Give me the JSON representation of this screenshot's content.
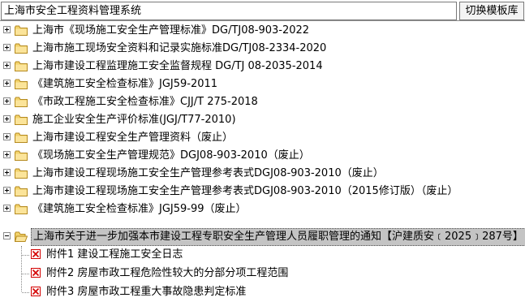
{
  "window": {
    "title": "上海市安全工程资料管理系统",
    "switch_button": "切换模板库"
  },
  "tree": {
    "items": [
      {
        "label": "上海市《现场施工安全生产管理标准》DG/TJ08-903-2022"
      },
      {
        "label": "上海市施工现场安全资料和记录实施标准DG/TJ08-2334-2020"
      },
      {
        "label": "上海市建设工程监理施工安全监督规程 DG/TJ 08-2035-2014"
      },
      {
        "label": "《建筑施工安全检查标准》JGJ59-2011"
      },
      {
        "label": "《市政工程施工安全检查标准》CJJ/T 275-2018"
      },
      {
        "label": "施工企业安全生产评价标准(JGJ/T77-2010)"
      },
      {
        "label": "上海市建设工程安全生产管理资料（废止）"
      },
      {
        "label": "《现场施工安全生产管理规范》DGJ08-903-2010（废止）"
      },
      {
        "label": "上海市建设工程现场施工安全生产管理参考表式DGJ08-903-2010（废止）"
      },
      {
        "label": "上海市建设工程现场施工安全生产管理参考表式DGJ08-903-2010（2015修订版）（废止）"
      },
      {
        "label": "《建筑施工安全检查标准》JGJ59-99（废止）"
      },
      {
        "label": "上海市关于进一步加强本市建设工程专职安全生产管理人员履职管理的通知【沪建质安﹝2025﹞287号】"
      }
    ],
    "children": [
      {
        "label": "附件1 建设工程施工安全日志"
      },
      {
        "label": "附件2 房屋市政工程危险性较大的分部分项工程范围"
      },
      {
        "label": "附件3 房屋市政工程重大事故隐患判定标准"
      }
    ]
  }
}
